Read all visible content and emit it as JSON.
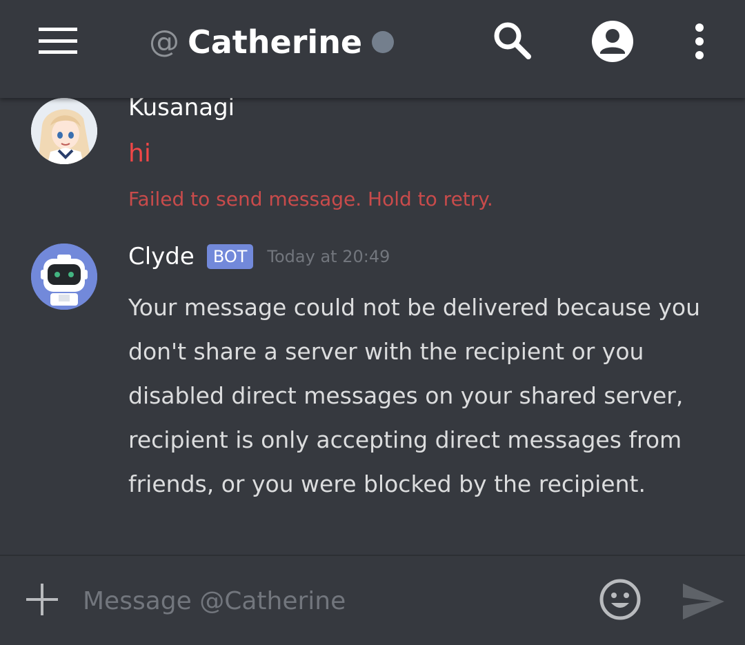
{
  "header": {
    "menu_icon": "hamburger-menu-icon",
    "at_symbol": "@",
    "title": "Catherine",
    "status_color": "#747f8d",
    "search_icon": "search-icon",
    "profile_icon": "user-profile-icon",
    "more_icon": "more-vertical-icon"
  },
  "messages": [
    {
      "username": "Kusanagi",
      "text": "hi",
      "error_notice": "Failed to send message. Hold to retry.",
      "text_color": "#f04747"
    },
    {
      "username": "Clyde",
      "badge": "BOT",
      "timestamp": "Today at 20:49",
      "text": "Your message could not be delivered because you don't share a server with the recipient or you disabled direct messages on your shared server, recipient is only accepting direct messages from friends, or you were blocked by the recipient."
    }
  ],
  "composer": {
    "add_icon": "plus-icon",
    "placeholder": "Message @Catherine",
    "emoji_icon": "emoji-smile-icon",
    "send_icon": "send-icon"
  },
  "colors": {
    "background": "#36393f",
    "accent": "#7289da",
    "error": "#f04747"
  }
}
